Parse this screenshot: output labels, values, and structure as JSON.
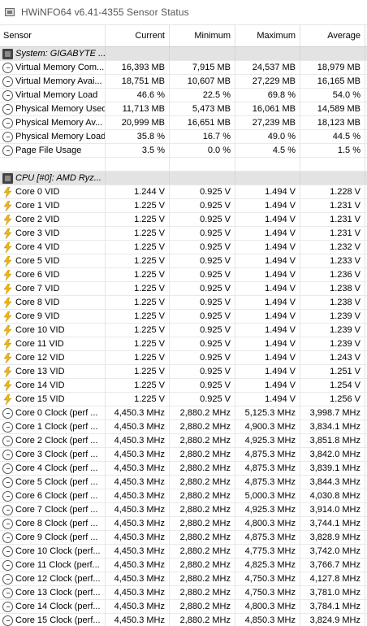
{
  "window": {
    "title": "HWiNFO64 v6.41-4355 Sensor Status"
  },
  "columns": [
    "Sensor",
    "Current",
    "Minimum",
    "Maximum",
    "Average"
  ],
  "rows": [
    {
      "kind": "group",
      "icon": "chip-icon",
      "label": "System: GIGABYTE ..."
    },
    {
      "kind": "data",
      "icon": "clock-icon",
      "label": "Virtual Memory Com...",
      "current": "16,393 MB",
      "min": "7,915 MB",
      "max": "24,537 MB",
      "avg": "18,979 MB"
    },
    {
      "kind": "data",
      "icon": "clock-icon",
      "label": "Virtual Memory Avai...",
      "current": "18,751 MB",
      "min": "10,607 MB",
      "max": "27,229 MB",
      "avg": "16,165 MB"
    },
    {
      "kind": "data",
      "icon": "clock-icon",
      "label": "Virtual Memory Load",
      "current": "46.6 %",
      "min": "22.5 %",
      "max": "69.8 %",
      "avg": "54.0 %"
    },
    {
      "kind": "data",
      "icon": "clock-icon",
      "label": "Physical Memory Used",
      "current": "11,713 MB",
      "min": "5,473 MB",
      "max": "16,061 MB",
      "avg": "14,589 MB"
    },
    {
      "kind": "data",
      "icon": "clock-icon",
      "label": "Physical Memory Av...",
      "current": "20,999 MB",
      "min": "16,651 MB",
      "max": "27,239 MB",
      "avg": "18,123 MB"
    },
    {
      "kind": "data",
      "icon": "clock-icon",
      "label": "Physical Memory Load",
      "current": "35.8 %",
      "min": "16.7 %",
      "max": "49.0 %",
      "avg": "44.5 %"
    },
    {
      "kind": "data",
      "icon": "clock-icon",
      "label": "Page File Usage",
      "current": "3.5 %",
      "min": "0.0 %",
      "max": "4.5 %",
      "avg": "1.5 %"
    },
    {
      "kind": "spacer"
    },
    {
      "kind": "group",
      "icon": "chip-icon",
      "label": "CPU [#0]: AMD Ryz..."
    },
    {
      "kind": "data",
      "icon": "bolt-icon",
      "label": "Core 0 VID",
      "current": "1.244 V",
      "min": "0.925 V",
      "max": "1.494 V",
      "avg": "1.228 V"
    },
    {
      "kind": "data",
      "icon": "bolt-icon",
      "label": "Core 1 VID",
      "current": "1.225 V",
      "min": "0.925 V",
      "max": "1.494 V",
      "avg": "1.231 V"
    },
    {
      "kind": "data",
      "icon": "bolt-icon",
      "label": "Core 2 VID",
      "current": "1.225 V",
      "min": "0.925 V",
      "max": "1.494 V",
      "avg": "1.231 V"
    },
    {
      "kind": "data",
      "icon": "bolt-icon",
      "label": "Core 3 VID",
      "current": "1.225 V",
      "min": "0.925 V",
      "max": "1.494 V",
      "avg": "1.231 V"
    },
    {
      "kind": "data",
      "icon": "bolt-icon",
      "label": "Core 4 VID",
      "current": "1.225 V",
      "min": "0.925 V",
      "max": "1.494 V",
      "avg": "1.232 V"
    },
    {
      "kind": "data",
      "icon": "bolt-icon",
      "label": "Core 5 VID",
      "current": "1.225 V",
      "min": "0.925 V",
      "max": "1.494 V",
      "avg": "1.233 V"
    },
    {
      "kind": "data",
      "icon": "bolt-icon",
      "label": "Core 6 VID",
      "current": "1.225 V",
      "min": "0.925 V",
      "max": "1.494 V",
      "avg": "1.236 V"
    },
    {
      "kind": "data",
      "icon": "bolt-icon",
      "label": "Core 7 VID",
      "current": "1.225 V",
      "min": "0.925 V",
      "max": "1.494 V",
      "avg": "1.238 V"
    },
    {
      "kind": "data",
      "icon": "bolt-icon",
      "label": "Core 8 VID",
      "current": "1.225 V",
      "min": "0.925 V",
      "max": "1.494 V",
      "avg": "1.238 V"
    },
    {
      "kind": "data",
      "icon": "bolt-icon",
      "label": "Core 9 VID",
      "current": "1.225 V",
      "min": "0.925 V",
      "max": "1.494 V",
      "avg": "1.239 V"
    },
    {
      "kind": "data",
      "icon": "bolt-icon",
      "label": "Core 10 VID",
      "current": "1.225 V",
      "min": "0.925 V",
      "max": "1.494 V",
      "avg": "1.239 V"
    },
    {
      "kind": "data",
      "icon": "bolt-icon",
      "label": "Core 11 VID",
      "current": "1.225 V",
      "min": "0.925 V",
      "max": "1.494 V",
      "avg": "1.239 V"
    },
    {
      "kind": "data",
      "icon": "bolt-icon",
      "label": "Core 12 VID",
      "current": "1.225 V",
      "min": "0.925 V",
      "max": "1.494 V",
      "avg": "1.243 V"
    },
    {
      "kind": "data",
      "icon": "bolt-icon",
      "label": "Core 13 VID",
      "current": "1.225 V",
      "min": "0.925 V",
      "max": "1.494 V",
      "avg": "1.251 V"
    },
    {
      "kind": "data",
      "icon": "bolt-icon",
      "label": "Core 14 VID",
      "current": "1.225 V",
      "min": "0.925 V",
      "max": "1.494 V",
      "avg": "1.254 V"
    },
    {
      "kind": "data",
      "icon": "bolt-icon",
      "label": "Core 15 VID",
      "current": "1.225 V",
      "min": "0.925 V",
      "max": "1.494 V",
      "avg": "1.256 V"
    },
    {
      "kind": "data",
      "icon": "clock-icon",
      "label": "Core 0 Clock (perf ...",
      "current": "4,450.3 MHz",
      "min": "2,880.2 MHz",
      "max": "5,125.3 MHz",
      "avg": "3,998.7 MHz"
    },
    {
      "kind": "data",
      "icon": "clock-icon",
      "label": "Core 1 Clock (perf ...",
      "current": "4,450.3 MHz",
      "min": "2,880.2 MHz",
      "max": "4,900.3 MHz",
      "avg": "3,834.1 MHz"
    },
    {
      "kind": "data",
      "icon": "clock-icon",
      "label": "Core 2 Clock (perf ...",
      "current": "4,450.3 MHz",
      "min": "2,880.2 MHz",
      "max": "4,925.3 MHz",
      "avg": "3,851.8 MHz"
    },
    {
      "kind": "data",
      "icon": "clock-icon",
      "label": "Core 3 Clock (perf ...",
      "current": "4,450.3 MHz",
      "min": "2,880.2 MHz",
      "max": "4,875.3 MHz",
      "avg": "3,842.0 MHz"
    },
    {
      "kind": "data",
      "icon": "clock-icon",
      "label": "Core 4 Clock (perf ...",
      "current": "4,450.3 MHz",
      "min": "2,880.2 MHz",
      "max": "4,875.3 MHz",
      "avg": "3,839.1 MHz"
    },
    {
      "kind": "data",
      "icon": "clock-icon",
      "label": "Core 5 Clock (perf ...",
      "current": "4,450.3 MHz",
      "min": "2,880.2 MHz",
      "max": "4,875.3 MHz",
      "avg": "3,844.3 MHz"
    },
    {
      "kind": "data",
      "icon": "clock-icon",
      "label": "Core 6 Clock (perf ...",
      "current": "4,450.3 MHz",
      "min": "2,880.2 MHz",
      "max": "5,000.3 MHz",
      "avg": "4,030.8 MHz"
    },
    {
      "kind": "data",
      "icon": "clock-icon",
      "label": "Core 7 Clock (perf ...",
      "current": "4,450.3 MHz",
      "min": "2,880.2 MHz",
      "max": "4,925.3 MHz",
      "avg": "3,914.0 MHz"
    },
    {
      "kind": "data",
      "icon": "clock-icon",
      "label": "Core 8 Clock (perf ...",
      "current": "4,450.3 MHz",
      "min": "2,880.2 MHz",
      "max": "4,800.3 MHz",
      "avg": "3,744.1 MHz"
    },
    {
      "kind": "data",
      "icon": "clock-icon",
      "label": "Core 9 Clock (perf ...",
      "current": "4,450.3 MHz",
      "min": "2,880.2 MHz",
      "max": "4,875.3 MHz",
      "avg": "3,828.9 MHz"
    },
    {
      "kind": "data",
      "icon": "clock-icon",
      "label": "Core 10 Clock (perf...",
      "current": "4,450.3 MHz",
      "min": "2,880.2 MHz",
      "max": "4,775.3 MHz",
      "avg": "3,742.0 MHz"
    },
    {
      "kind": "data",
      "icon": "clock-icon",
      "label": "Core 11 Clock (perf...",
      "current": "4,450.3 MHz",
      "min": "2,880.2 MHz",
      "max": "4,825.3 MHz",
      "avg": "3,766.7 MHz"
    },
    {
      "kind": "data",
      "icon": "clock-icon",
      "label": "Core 12 Clock (perf...",
      "current": "4,450.3 MHz",
      "min": "2,880.2 MHz",
      "max": "4,750.3 MHz",
      "avg": "4,127.8 MHz"
    },
    {
      "kind": "data",
      "icon": "clock-icon",
      "label": "Core 13 Clock (perf...",
      "current": "4,450.3 MHz",
      "min": "2,880.2 MHz",
      "max": "4,750.3 MHz",
      "avg": "3,781.0 MHz"
    },
    {
      "kind": "data",
      "icon": "clock-icon",
      "label": "Core 14 Clock (perf...",
      "current": "4,450.3 MHz",
      "min": "2,880.2 MHz",
      "max": "4,800.3 MHz",
      "avg": "3,784.1 MHz"
    },
    {
      "kind": "data",
      "icon": "clock-icon",
      "label": "Core 15 Clock (perf...",
      "current": "4,450.3 MHz",
      "min": "2,880.2 MHz",
      "max": "4,850.3 MHz",
      "avg": "3,824.9 MHz"
    }
  ],
  "colors": {
    "bolt": "#f2b705",
    "group_bg": "#e3e3e3"
  }
}
